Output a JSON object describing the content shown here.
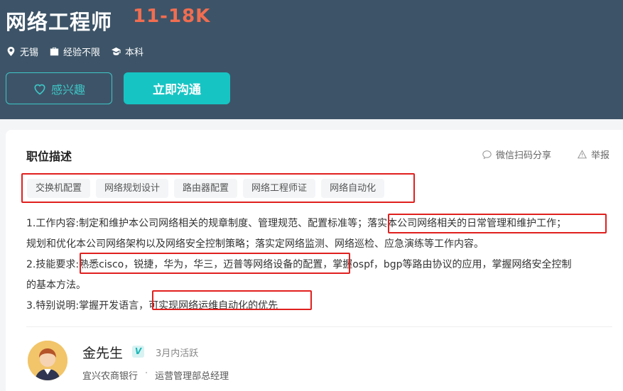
{
  "job": {
    "title": "网络工程师",
    "salary": "11-18K",
    "location": "无锡",
    "experience": "经验不限",
    "education": "本科"
  },
  "actions": {
    "interest_label": "感兴趣",
    "chat_label": "立即沟通"
  },
  "description": {
    "section_title": "职位描述",
    "share_label": "微信扫码分享",
    "report_label": "举报",
    "tags": [
      "交换机配置",
      "网络规划设计",
      "路由器配置",
      "网络工程师证",
      "网络自动化"
    ],
    "lines": [
      "1.工作内容:制定和维护本公司网络相关的规章制度、管理规范、配置标准等；落实本公司网络相关的日常管理和维护工作；",
      "规划和优化本公司网络架构以及网络安全控制策略；落实定网络监测、网络巡检、应急演练等工作内容。",
      "2.技能要求:熟悉cisco，锐捷，华为，华三，迈普等网络设备的配置，掌握ospf，bgp等路由协议的应用，掌握网络安全控制",
      "的基本方法。",
      "3.特别说明:掌握开发语言，可实现网络运维自动化的优先"
    ]
  },
  "recruiter": {
    "name": "金先生",
    "verified_badge": "V",
    "active_status": "3月内活跃",
    "company": "宜兴农商银行",
    "position": "运营管理部总经理"
  },
  "colors": {
    "header_bg": "#3d5468",
    "salary": "#f26d50",
    "accent": "#17c4c4",
    "highlight_box": "#e0201e"
  }
}
